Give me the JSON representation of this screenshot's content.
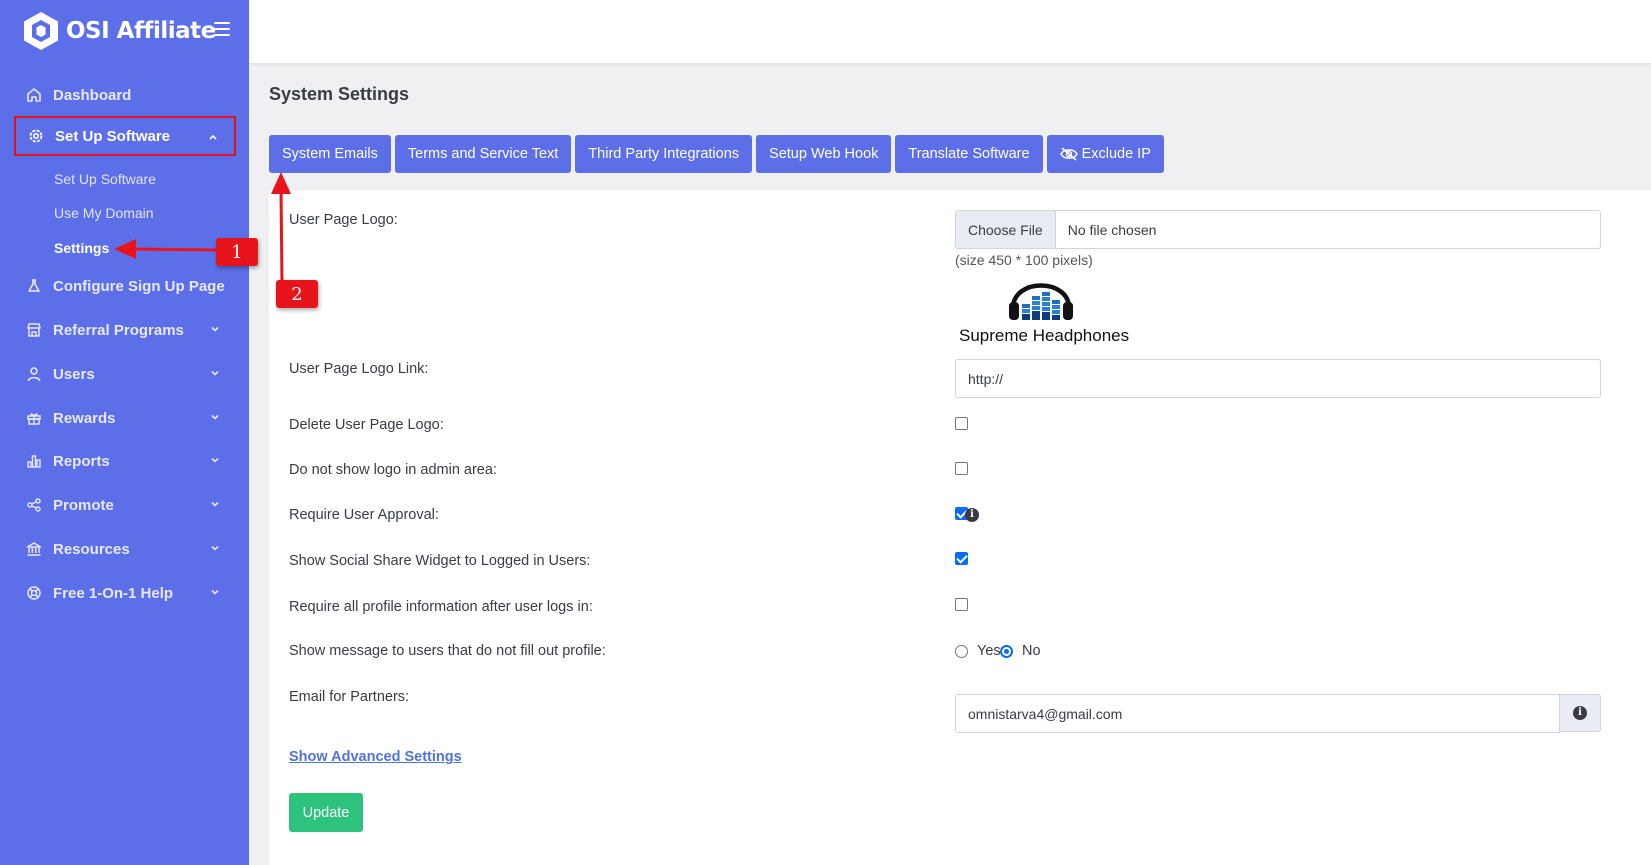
{
  "brand": {
    "name": "OSI Affiliate"
  },
  "sidebar": {
    "items": [
      {
        "label": "Dashboard",
        "icon": "home-icon"
      },
      {
        "label": "Set Up Software",
        "icon": "gear-icon",
        "active": true
      },
      {
        "label": "Configure Sign Up Page",
        "icon": "flask-icon"
      },
      {
        "label": "Referral Programs",
        "icon": "store-icon"
      },
      {
        "label": "Users",
        "icon": "user-icon"
      },
      {
        "label": "Rewards",
        "icon": "gift-icon"
      },
      {
        "label": "Reports",
        "icon": "bar-chart-icon"
      },
      {
        "label": "Promote",
        "icon": "share-icon"
      },
      {
        "label": "Resources",
        "icon": "bank-icon"
      },
      {
        "label": "Free 1-On-1 Help",
        "icon": "lifebuoy-icon"
      }
    ],
    "subitems": [
      {
        "label": "Set Up Software"
      },
      {
        "label": "Use My Domain"
      },
      {
        "label": "Settings",
        "current": true
      }
    ]
  },
  "page": {
    "title": "System Settings"
  },
  "tabs": [
    {
      "label": "System Emails"
    },
    {
      "label": "Terms and Service Text"
    },
    {
      "label": "Third Party Integrations"
    },
    {
      "label": "Setup Web Hook"
    },
    {
      "label": "Translate Software"
    },
    {
      "label": "Exclude IP",
      "icon": "eye-slash-icon"
    }
  ],
  "form": {
    "user_page_logo": {
      "label": "User Page Logo:",
      "button": "Choose File",
      "file_status": "No file chosen",
      "hint": "(size 450 * 100 pixels)",
      "logo_caption": "Supreme Headphones"
    },
    "logo_link": {
      "label": "User Page Logo Link:",
      "value": "http://"
    },
    "delete_logo": {
      "label": "Delete User Page Logo:",
      "checked": false
    },
    "hide_admin_logo": {
      "label": "Do not show logo in admin area:",
      "checked": false
    },
    "require_approval": {
      "label": "Require User Approval:",
      "checked": true
    },
    "social_share": {
      "label": "Show Social Share Widget to Logged in Users:",
      "checked": true
    },
    "require_profile": {
      "label": "Require all profile information after user logs in:",
      "checked": false
    },
    "profile_message": {
      "label": "Show message to users that do not fill out profile:",
      "yes": "Yes",
      "no": "No",
      "selected": "No"
    },
    "partner_email": {
      "label": "Email for Partners:",
      "value": "omnistarva4@gmail.com"
    },
    "advanced_link": "Show Advanced Settings",
    "update_button": "Update"
  },
  "annotations": {
    "badge_1": "1",
    "badge_2": "2"
  },
  "colors": {
    "sidebar": "#5d6fe8",
    "tab": "#5d6fe8",
    "update": "#2ec37c",
    "annotation": "#e8141b",
    "link": "#4e73df"
  }
}
